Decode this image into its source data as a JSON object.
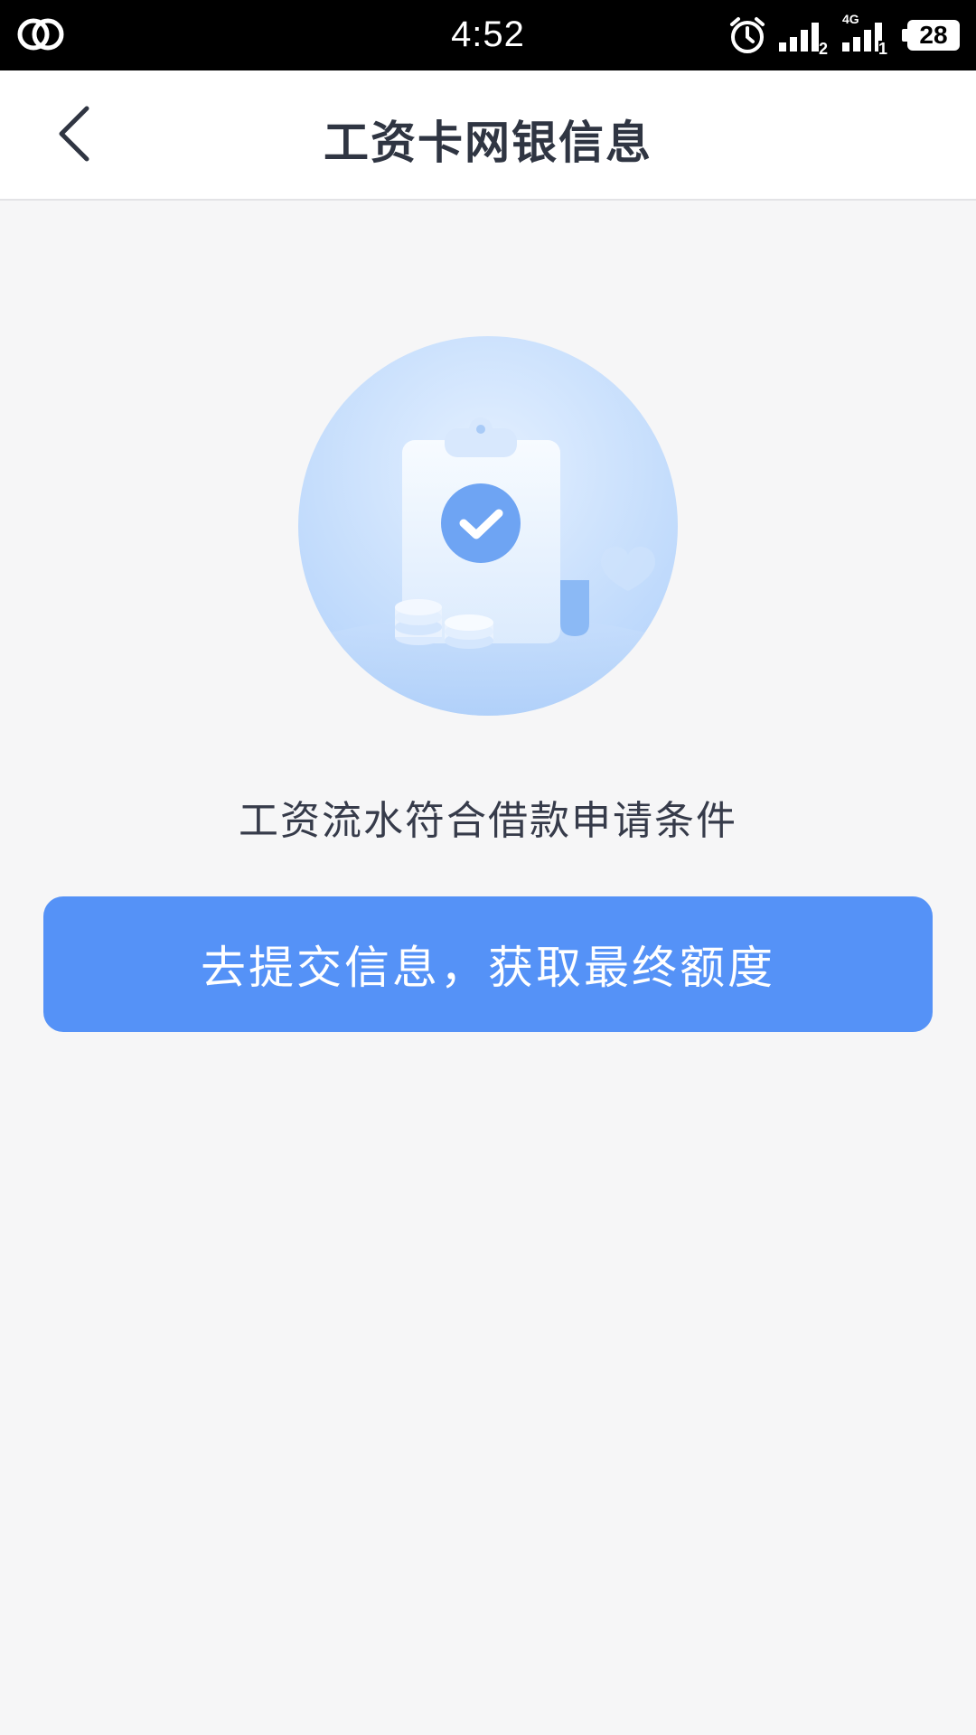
{
  "status_bar": {
    "time": "4:52",
    "sim2_label": "2",
    "network_label": "4G",
    "sim1_label": "1",
    "battery": "28",
    "icons": [
      "app-notification-icon",
      "alarm-icon",
      "signal-icon",
      "signal-4g-icon",
      "battery-icon"
    ]
  },
  "nav": {
    "title": "工资卡网银信息",
    "back_icon": "chevron-left-icon"
  },
  "main": {
    "illustration_icon": "clipboard-check-icon",
    "message": "工资流水符合借款申请条件",
    "button_label": "去提交信息，获取最终额度"
  },
  "colors": {
    "accent": "#5592f7",
    "background": "#f6f6f7",
    "title_text": "#2f3542",
    "body_text": "#363b4a"
  }
}
